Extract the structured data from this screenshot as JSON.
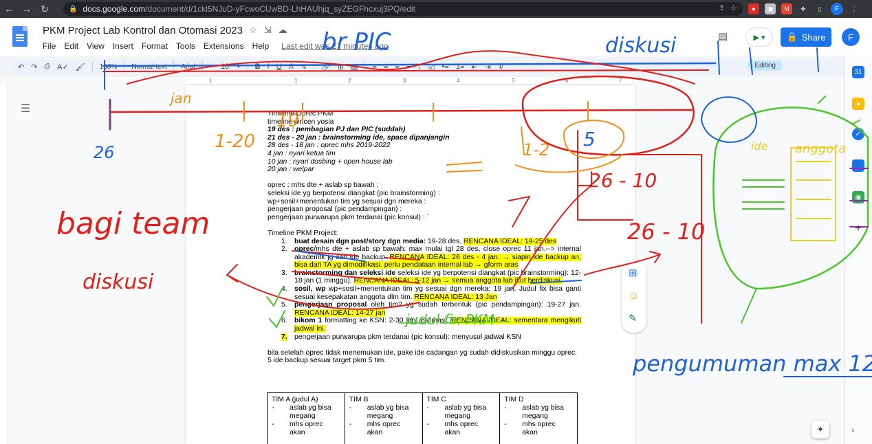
{
  "browser": {
    "url_host": "docs.google.com",
    "url_path": "/document/d/1ckl5NJuD-yFcwoCUwBD-LhHAUhjq_syZEGFhcxuj3PQ/edit",
    "profile_initial": "F"
  },
  "docs": {
    "title": "PKM Project Lab Kontrol dan Otomasi 2023",
    "menu": [
      "File",
      "Edit",
      "View",
      "Insert",
      "Format",
      "Tools",
      "Extensions",
      "Help"
    ],
    "last_edit": "Last edit was 27 minutes ago",
    "share_label": "Share",
    "user_initial": "F",
    "toolbar": {
      "zoom": "100%",
      "style": "Normal text",
      "font": "Arial",
      "mode": "Editing"
    },
    "ruler_numbers": [
      "1",
      "1",
      "2",
      "3",
      "4",
      "5",
      "6",
      "7"
    ]
  },
  "content": {
    "lines_top": [
      {
        "text": "Timeline Oprec PKM",
        "style": "bullet"
      },
      {
        "text": "timeline pincen yosia",
        "style": "normal"
      },
      {
        "text": "19 des : pembagian PJ dan PIC (suddah)",
        "style": "bold-italic"
      },
      {
        "text": "21 des - 20 jan : brainstorming ide, space dipanjangin",
        "style": "bold-italic"
      },
      {
        "text": "28 des - 18 jan : oprec mhs 2019-2022",
        "style": "italic"
      },
      {
        "text": "4 jan : nyari ketua tim",
        "style": "italic"
      },
      {
        "text": "10 jan : nyari dosbing + open house lab",
        "style": "italic"
      },
      {
        "text": "20 jan : welpar",
        "style": "italic"
      }
    ],
    "lines_oprec": [
      "oprec : mhs dte + aslab sp bawah :",
      "seleksi ide yg berpotensi diangkat (pic brainstorming) :",
      "wp+sosil+menentukan tim yg sesuai dgn mereka :",
      "pengerjaan proposal (pic pendampingan) :",
      "pengerjaan purwarupa pkm terdanai (pic konsul) : `"
    ],
    "timeline_title": "Timeline PKM Project:",
    "timeline": [
      {
        "num": "1.",
        "lead": "buat desain dgn post/story dgn media:",
        "body": " 19-28 des. ",
        "ideal": "RENCANA IDEAL:  19-25 des",
        "tail": ""
      },
      {
        "num": "2.",
        "lead": "oprec",
        "body": "/mhs dte + aslab sp bawah: max mulai tgl 28 des, close oprec 11 jan.--> internal akademik jg cari ide backup. ",
        "ideal": "RENCANA IDEAL: 26 des - 4 jan. → siapin ide backup an, bisa dari TA yg dimodifikasi. perlu pendataan internal lab → gform aras",
        "tail": ""
      },
      {
        "num": "3.",
        "lead": "brainstorming dan seleksi ide",
        "body": " seleksi ide yg berpotensi diangkat (pic brainstorming): 12-18 jan (1 minggu). ",
        "ideal": "RENCANA IDEAL: 5-12 jan → semua anggota lab ikut berdiskusi.",
        "tail": ""
      },
      {
        "num": "4.",
        "lead": "sosil, wp",
        "body": " wp+sosil+menentukan tim yg sesuai dgn mereka: 19 jan. Judul fix bisa ganti sesuai kesepakatan anggota dlm tim. ",
        "ideal": "RENCANA IDEAL: 13 Jan",
        "tail": ""
      },
      {
        "num": "5.",
        "lead": "pengerjaan proposal",
        "body": " oleh tim2 yg sudah terbentuk (pic pendampingan): 19-27 jan. ",
        "ideal": "RENCANA IDEAL: 14-27 jan",
        "tail": ""
      },
      {
        "num": "6.",
        "lead": "bikom 1",
        "body": " formatting ke KSN: 2-30 jan, estimasi. ",
        "ideal": "RENCANA IDEAL: sementara mengikuti jadwal ini.",
        "tail": ""
      },
      {
        "num": "7.",
        "lead": "",
        "body": "pengerjaan purwarupa pkm terdanai (pic konsul): menyusul jadwal KSN",
        "ideal": "",
        "tail": ""
      }
    ],
    "closing": [
      "bila setelah oprec tidak menemukan ide, pake ide cadangan yg sudah didiskusikan minggu oprec.",
      "5 ide backup sesuai target pkm 5 tim."
    ],
    "tim_table": [
      {
        "head": "TIM A (judul A)",
        "items": [
          "aslab yg bisa megang",
          "mhs oprec akan"
        ]
      },
      {
        "head": "TIM B",
        "items": [
          "aslab yg bisa megang",
          "mhs oprec akan"
        ]
      },
      {
        "head": "TIM C",
        "items": [
          "aslab yg bisa megang",
          "mhs oprec akan"
        ]
      },
      {
        "head": "TIM D",
        "items": [
          "aslab yg bisa megang",
          "mhs oprec akan"
        ]
      }
    ]
  },
  "handwriting": {
    "colors": {
      "red": "#e0201b",
      "blue": "#1e63d6",
      "orange": "#f0901a",
      "green": "#4cc62a",
      "yellow": "#e7d02a"
    },
    "texts": {
      "br_pic": "br PIC",
      "diskusi_top": "diskusi",
      "bagi_team": "bagi team",
      "diskusi_left": "diskusi",
      "pengumuman": "pengumuman max 12",
      "judul_fix": "judul fix PKM",
      "n26_left": "26",
      "n26_mid": "26 - 10",
      "n26_red": "26 - 10",
      "n1_2": "1-2",
      "n5": "5",
      "ide": "ide",
      "anggota": "anggota",
      "jan": "jan",
      "d19": "19",
      "n1_20": "1-20"
    }
  }
}
